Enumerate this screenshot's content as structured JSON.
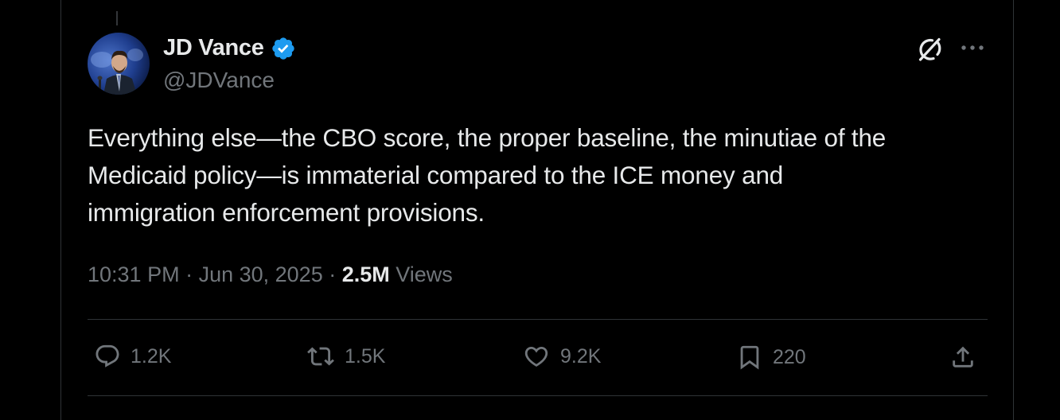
{
  "author": {
    "display_name": "JD Vance",
    "handle": "@JDVance",
    "verified": true,
    "verified_color": "#1d9bf0"
  },
  "tweet": {
    "lines": [
      "Everything else—the CBO score, the proper baseline, the minutiae of the",
      "Medicaid policy—is immaterial compared to the ICE money and",
      "immigration enforcement provisions."
    ]
  },
  "meta": {
    "time": "10:31 PM",
    "separator": " · ",
    "date": "Jun 30, 2025",
    "views_count": "2.5M",
    "views_label": "Views"
  },
  "actions": {
    "replies": "1.2K",
    "reposts": "1.5K",
    "likes": "9.2K",
    "bookmarks": "220"
  },
  "icons": {
    "grok": "grok-icon",
    "more": "more-icon",
    "reply": "reply-icon",
    "repost": "repost-icon",
    "like": "heart-icon",
    "bookmark": "bookmark-icon",
    "share": "share-icon"
  },
  "colors": {
    "background": "#000000",
    "text_primary": "#e7e9ea",
    "text_secondary": "#71767b",
    "divider": "#2f3336"
  }
}
